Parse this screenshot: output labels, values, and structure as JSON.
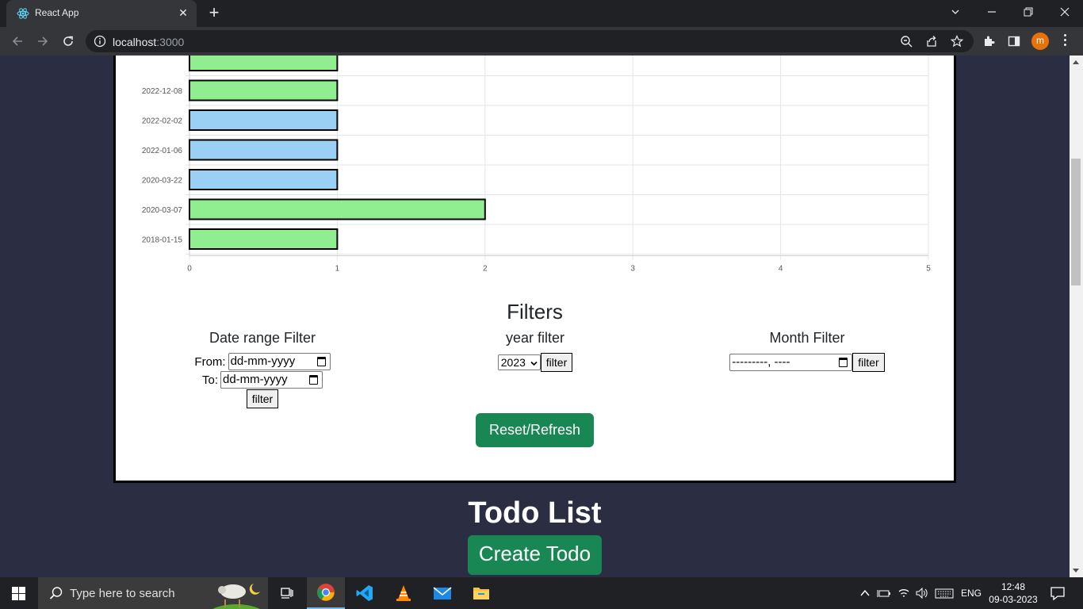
{
  "browser": {
    "tab_title": "React App",
    "url_host": "localhost",
    "url_port": ":3000"
  },
  "chart_data": {
    "type": "bar",
    "orientation": "horizontal",
    "categories": [
      "",
      "2022-12-08",
      "2022-02-02",
      "2022-01-06",
      "2020-03-22",
      "2020-03-07",
      "2018-01-15"
    ],
    "values": [
      1,
      1,
      1,
      1,
      1,
      2,
      1
    ],
    "bar_colors": [
      "#90ee90",
      "#90ee90",
      "#9bd0f5",
      "#9bd0f5",
      "#9bd0f5",
      "#90ee90",
      "#90ee90"
    ],
    "x_ticks": [
      "0",
      "1",
      "2",
      "3",
      "4",
      "5"
    ],
    "xlim": [
      0,
      5
    ],
    "grid": true
  },
  "filters": {
    "title": "Filters",
    "date_range": {
      "heading": "Date range Filter",
      "from_label": "From:",
      "from_value": "dd-mm-yyyy",
      "to_label": "To:",
      "to_value": "dd-mm-yyyy",
      "button": "filter"
    },
    "year": {
      "heading": "year filter",
      "selected": "2023",
      "button": "filter"
    },
    "month": {
      "heading": "Month Filter",
      "value": "---------, ----",
      "button": "filter"
    }
  },
  "reset_button": "Reset/Refresh",
  "todo": {
    "title": "Todo List",
    "create_button": "Create Todo"
  },
  "taskbar": {
    "search_placeholder": "Type here to search",
    "language": "ENG",
    "time": "12:48",
    "date": "09-03-2023"
  },
  "colors": {
    "accent_green": "#198754",
    "page_bg": "#2b2e42",
    "bar_green": "#90ee90",
    "bar_blue": "#9bd0f5"
  }
}
